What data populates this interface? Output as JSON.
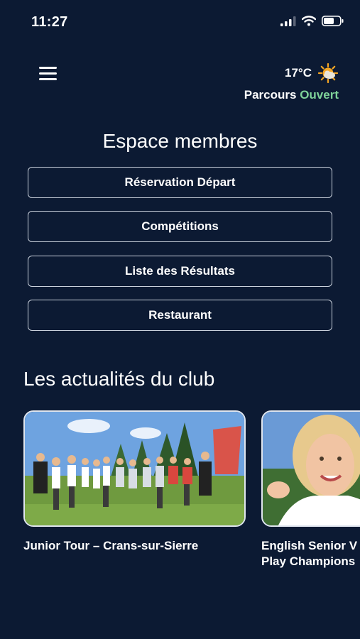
{
  "status_bar": {
    "time": "11:27"
  },
  "header": {
    "temperature": "17°C",
    "course_label": "Parcours",
    "course_status": "Ouvert",
    "weather_icon": "partly-sunny-icon"
  },
  "members": {
    "title": "Espace membres",
    "buttons": [
      "Réservation Départ",
      "Compétitions",
      "Liste des Résultats",
      "Restaurant"
    ]
  },
  "news": {
    "title": "Les actualités du club",
    "items": [
      {
        "title": "Junior Tour – Crans-sur-Sierre"
      },
      {
        "title_line1": "English Senior V",
        "title_line2": "Play Champions"
      }
    ]
  },
  "colors": {
    "background": "#0c1a33",
    "accent_open": "#7fd39a"
  }
}
